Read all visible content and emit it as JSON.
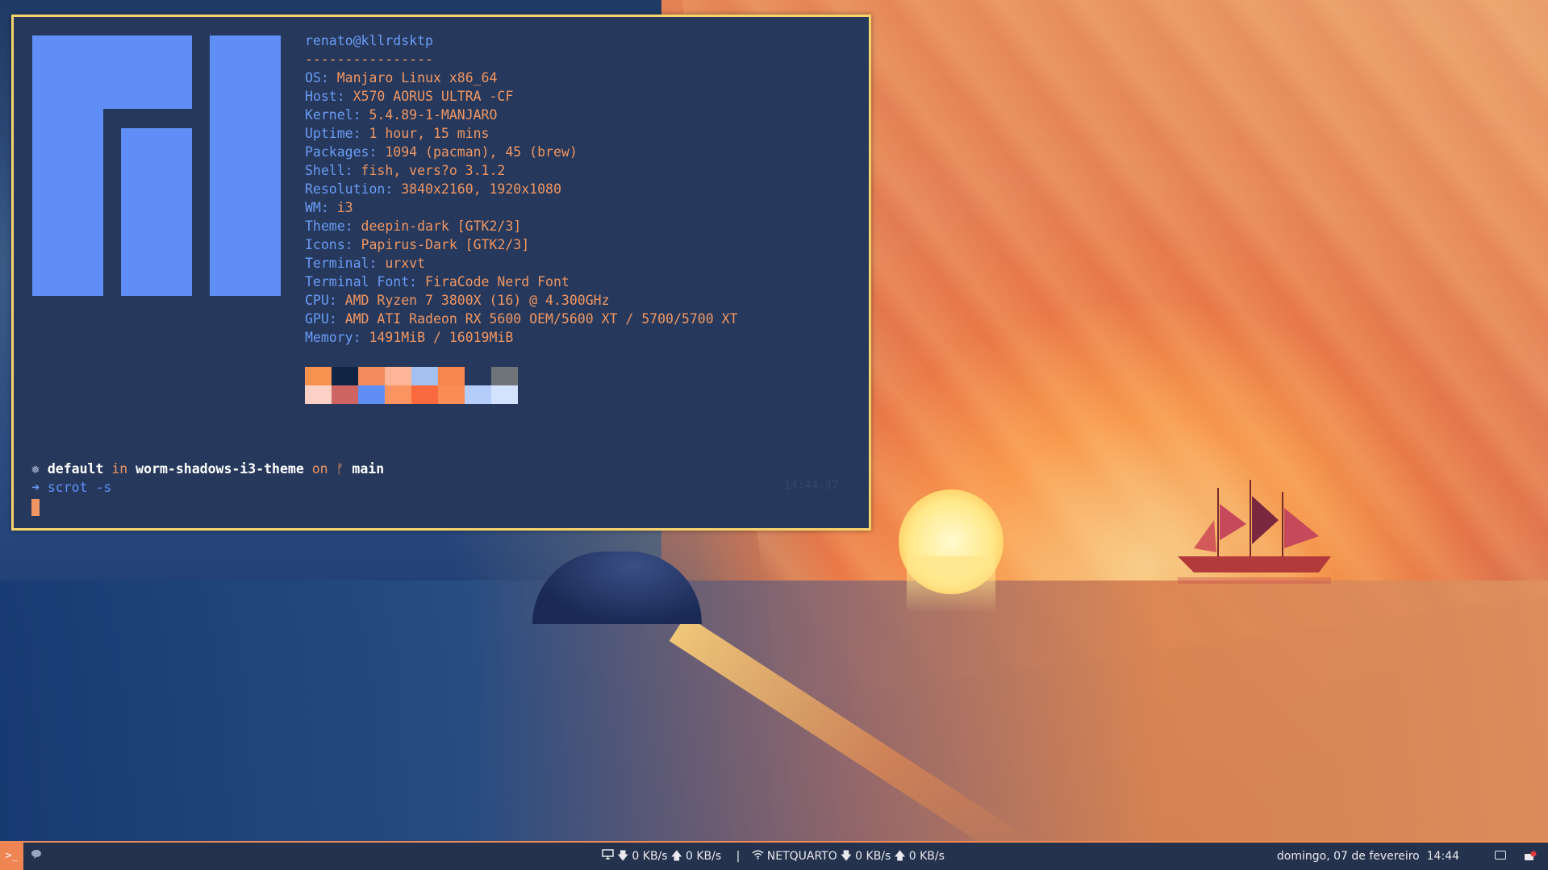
{
  "terminal": {
    "header": "renato@kllrdsktp",
    "separator": "----------------",
    "info": [
      {
        "key": "OS",
        "value": "Manjaro Linux x86_64"
      },
      {
        "key": "Host",
        "value": "X570 AORUS ULTRA -CF"
      },
      {
        "key": "Kernel",
        "value": "5.4.89-1-MANJARO"
      },
      {
        "key": "Uptime",
        "value": "1 hour, 15 mins"
      },
      {
        "key": "Packages",
        "value": "1094 (pacman), 45 (brew)"
      },
      {
        "key": "Shell",
        "value": "fish, vers?o 3.1.2"
      },
      {
        "key": "Resolution",
        "value": "3840x2160, 1920x1080"
      },
      {
        "key": "WM",
        "value": "i3"
      },
      {
        "key": "Theme",
        "value": "deepin-dark [GTK2/3]"
      },
      {
        "key": "Icons",
        "value": "Papirus-Dark [GTK2/3]"
      },
      {
        "key": "Terminal",
        "value": "urxvt"
      },
      {
        "key": "Terminal Font",
        "value": "FiraCode Nerd Font"
      },
      {
        "key": "CPU",
        "value": "AMD Ryzen 7 3800X (16) @ 4.300GHz"
      },
      {
        "key": "GPU",
        "value": "AMD ATI Radeon RX 5600 OEM/5600 XT / 5700/5700 XT"
      },
      {
        "key": "Memory",
        "value": "1491MiB / 16019MiB"
      }
    ],
    "palette_top": [
      "#f7914f",
      "#102545",
      "#f38b5c",
      "#fdb597",
      "#a3c0ef",
      "#f7864f",
      "#26395c",
      "#6f7478"
    ],
    "palette_bottom": [
      "#fbd1c5",
      "#cf6562",
      "#5f8ff6",
      "#fb9461",
      "#fb6a3f",
      "#fb8c53",
      "#b5cdfb",
      "#d3e2fd"
    ],
    "prompt": {
      "symbol": "❅",
      "env": "default",
      "in": "in",
      "dir": "worm-shadows-i3-theme",
      "on": "on",
      "branch_icon": "ᚠ",
      "branch": "main",
      "arrow": "➜",
      "command": "scrot -s",
      "right_time": "14:44:37"
    },
    "colors": {
      "border": "#f6d36b",
      "background": "#26395c",
      "key": "#6b9cf6",
      "value": "#f19662",
      "logo": "#5f8ff6"
    }
  },
  "taskbar": {
    "terminal_icon": "terminal-icon",
    "terminal_glyph": ">_",
    "chat_icon": "chat-bubble-icon",
    "display_icon": "monitor-icon",
    "down1": "0 KB/s",
    "up1": "0 KB/s",
    "divider": "|",
    "wifi_icon": "wifi-icon",
    "network_name": "NETQUARTO",
    "down2": "0 KB/s",
    "up2": "0 KB/s",
    "date": "domingo, 07 de fevereiro",
    "time": "14:44",
    "tray_icons": [
      "screen-icon",
      "app-tray-icon"
    ],
    "accent": "#ef8553"
  }
}
